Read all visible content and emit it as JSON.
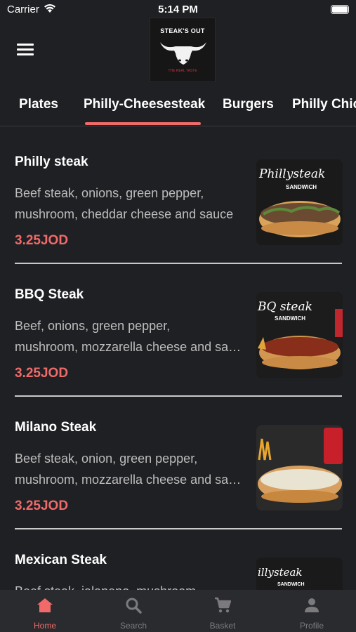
{
  "status": {
    "carrier": "Carrier",
    "time": "5:14 PM"
  },
  "header": {
    "logo_title": "STEAK'S OUT",
    "logo_subtitle": "THE REAL TASTE"
  },
  "tabs": [
    {
      "label": "Plates",
      "active": false
    },
    {
      "label": "Philly-Cheesesteak",
      "active": true
    },
    {
      "label": "Burgers",
      "active": false
    },
    {
      "label": "Philly Chicken",
      "active": false
    }
  ],
  "items": [
    {
      "name": "Philly steak",
      "desc_line1": "Beef steak, onions, green pepper,",
      "desc_line2": "mushroom, cheddar cheese and sauce",
      "price": "3.25JOD",
      "image_caption": "Phillysteak",
      "image_sub": "SANDWICH"
    },
    {
      "name": "BBQ Steak",
      "desc_line1": "Beef, onions, green pepper,",
      "desc_line2": "mushroom, mozzarella cheese and sauce",
      "price": "3.25JOD",
      "image_caption": "BQ steak",
      "image_sub": "SANDWICH"
    },
    {
      "name": "Milano Steak",
      "desc_line1": "Beef steak, onion, green pepper,",
      "desc_line2": "mushroom, mozzarella cheese and sauce",
      "price": "3.25JOD",
      "image_caption": "",
      "image_sub": ""
    },
    {
      "name": "Mexican Steak",
      "desc_line1": "Beef steak, jalapeno, mushroom,",
      "desc_line2": "",
      "price": "",
      "image_caption": "illysteak",
      "image_sub": "SANDWICH"
    }
  ],
  "bottom_nav": [
    {
      "label": "Home",
      "icon": "home-icon",
      "active": true
    },
    {
      "label": "Search",
      "icon": "search-icon",
      "active": false
    },
    {
      "label": "Basket",
      "icon": "cart-icon",
      "active": false
    },
    {
      "label": "Profile",
      "icon": "profile-icon",
      "active": false
    }
  ],
  "colors": {
    "background": "#1f2023",
    "accent": "#f06a6a",
    "nav_bg": "#2a2b2e",
    "muted_text": "#bdbdbd"
  }
}
